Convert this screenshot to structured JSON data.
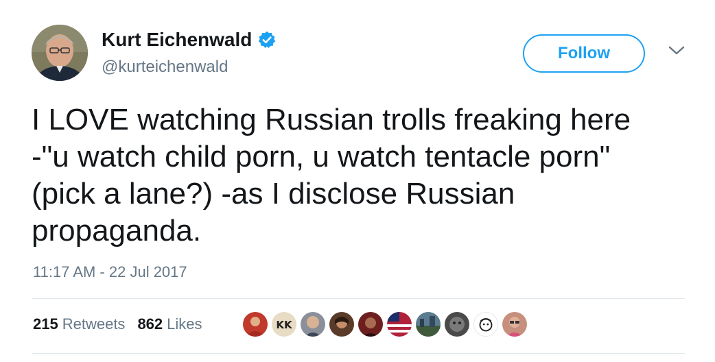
{
  "user": {
    "display_name": "Kurt Eichenwald",
    "handle": "@kurteichenwald",
    "verified_icon": "verified-badge-icon",
    "avatar_icon": "profile-photo"
  },
  "follow_button": {
    "label": "Follow",
    "color": "#1da1f2"
  },
  "more_menu": {
    "icon": "chevron-down-icon"
  },
  "tweet": {
    "lines": [
      "I LOVE watching Russian trolls freaking here",
      "-\"u watch child porn, u watch tentacle porn\"",
      "(pick a lane?) -as I disclose Russian",
      "propaganda."
    ],
    "timestamp": "11:17 AM - 22 Jul 2017"
  },
  "stats": {
    "retweets": {
      "count": "215",
      "label": "Retweets"
    },
    "likes": {
      "count": "862",
      "label": "Likes"
    }
  },
  "likers": [
    {
      "icon": "liker-avatar",
      "bg": "#c0392b"
    },
    {
      "icon": "liker-avatar",
      "bg": "#e8dcc4"
    },
    {
      "icon": "liker-avatar",
      "bg": "#8a8f99"
    },
    {
      "icon": "liker-avatar",
      "bg": "#5a3b2a"
    },
    {
      "icon": "liker-avatar",
      "bg": "#6d1f1f"
    },
    {
      "icon": "liker-avatar",
      "bg": "#b0223a"
    },
    {
      "icon": "liker-avatar",
      "bg": "#5b7b8f"
    },
    {
      "icon": "liker-avatar",
      "bg": "#4a4a4a"
    },
    {
      "icon": "liker-avatar",
      "bg": "#ffffff"
    },
    {
      "icon": "liker-avatar",
      "bg": "#c78f7d"
    }
  ],
  "colors": {
    "text": "#14171a",
    "secondary": "#657786",
    "accent": "#1da1f2",
    "divider": "#e1e8ed"
  }
}
